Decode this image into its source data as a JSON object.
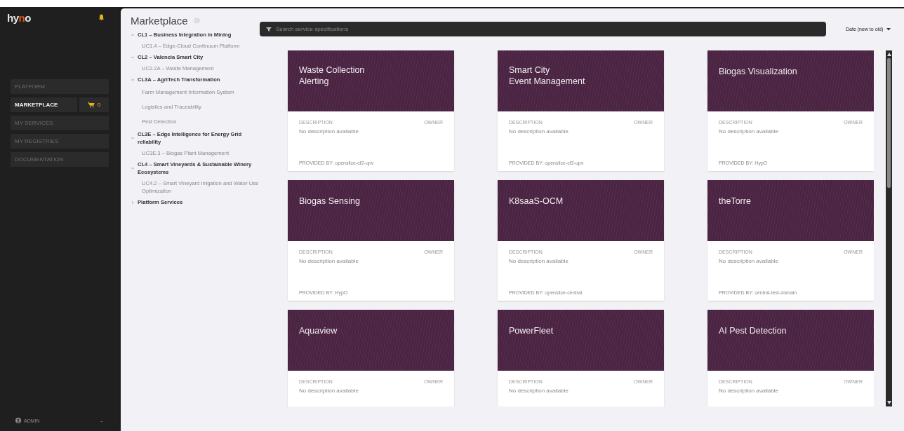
{
  "brand": {
    "prefix": "hy",
    "accent": "n",
    "suffix": "o"
  },
  "sidebar": {
    "items": [
      {
        "label": "PLATFORM",
        "selected": false
      },
      {
        "label": "MARKETPLACE",
        "selected": true
      },
      {
        "label": "MY SERVICES",
        "selected": false
      },
      {
        "label": "MY REGISTRIES",
        "selected": false
      },
      {
        "label": "DOCUMENTATION",
        "selected": false
      }
    ],
    "cart_count": "0",
    "user": "ADMIN",
    "user_toggle": "–"
  },
  "marketplace": {
    "title": "Marketplace",
    "tree": [
      {
        "label": "CL1 – Business Integration in Mining",
        "expanded": true,
        "children": [
          {
            "label": "UC1.4 – Edge-Cloud Continuum Platform"
          }
        ]
      },
      {
        "label": "CL2 – Valencia Smart City",
        "expanded": true,
        "children": [
          {
            "label": "UC2.2A – Waste Management"
          }
        ]
      },
      {
        "label": "CL3A – AgriTech Transformation",
        "expanded": true,
        "children": [
          {
            "label": "Farm Management Information System"
          },
          {
            "label": "Logistics and Traceability"
          },
          {
            "label": "Pest Detection"
          }
        ]
      },
      {
        "label": "CL3E – Edge Intelligence for Energy Grid reliability",
        "expanded": true,
        "children": [
          {
            "label": "UC3E.3 – Biogas Plant Management"
          }
        ]
      },
      {
        "label": "CL4 – Smart Vineyards & Sustainable Winery Ecosystems",
        "expanded": true,
        "children": [
          {
            "label": "UC4.2 – Smart Vineyard Irrigation and Water Use Optimization"
          }
        ]
      },
      {
        "label": "Platform Services",
        "expanded": false
      }
    ]
  },
  "search": {
    "placeholder": "Search service specifications"
  },
  "sort": {
    "label": "Date (new to old)"
  },
  "cards": [
    {
      "title": "Waste Collection\nAlerting",
      "description_label": "DESCRIPTION",
      "owner_label": "OWNER",
      "description": "No description available",
      "provided_by": "PROVIDED BY: openslice-cf2-upv"
    },
    {
      "title": "Smart City\nEvent Management",
      "description_label": "DESCRIPTION",
      "owner_label": "OWNER",
      "description": "No description available",
      "provided_by": "PROVIDED BY: openslice-cf2-upv"
    },
    {
      "title": "Biogas Visualization",
      "description_label": "DESCRIPTION",
      "owner_label": "OWNER",
      "description": "No description available",
      "provided_by": "PROVIDED BY: HypO"
    },
    {
      "title": "Biogas Sensing",
      "description_label": "DESCRIPTION",
      "owner_label": "OWNER",
      "description": "No description available",
      "provided_by": "PROVIDED BY: HypO"
    },
    {
      "title": "K8saaS-OCM",
      "description_label": "DESCRIPTION",
      "owner_label": "OWNER",
      "description": "No description available",
      "provided_by": "PROVIDED BY: openslice-central"
    },
    {
      "title": "theTorre",
      "description_label": "DESCRIPTION",
      "owner_label": "OWNER",
      "description": "No description available",
      "provided_by": "PROVIDED BY: central-test-domain"
    },
    {
      "title": "Aquaview",
      "description_label": "DESCRIPTION",
      "owner_label": "OWNER",
      "description": "No description available"
    },
    {
      "title": "PowerFleet",
      "description_label": "DESCRIPTION",
      "owner_label": "OWNER",
      "description": "No description available"
    },
    {
      "title": "AI Pest Detection",
      "description_label": "DESCRIPTION",
      "owner_label": "OWNER",
      "description": "No description available"
    }
  ]
}
